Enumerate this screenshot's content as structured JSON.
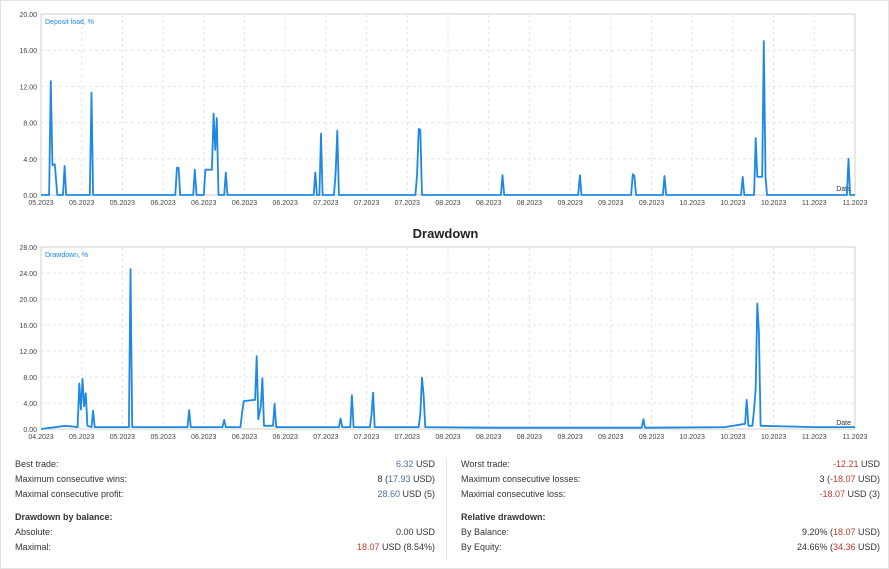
{
  "charts": {
    "deposit_load": {
      "series_label": "Deposit load, %",
      "ticks_y": [
        "0.00",
        "4.00",
        "8.00",
        "12.00",
        "16.00",
        "20.00"
      ],
      "ticks_x": [
        "05.2023",
        "05.2023",
        "05.2023",
        "06.2023",
        "06.2023",
        "06.2023",
        "06.2023",
        "07.2023",
        "07.2023",
        "07.2023",
        "08.2023",
        "08.2023",
        "08.2023",
        "09.2023",
        "09.2023",
        "09.2023",
        "10.2023",
        "10.2023",
        "10.2023",
        "11.2023",
        "11.2023"
      ],
      "x_label": "Date"
    },
    "drawdown": {
      "title": "Drawdown",
      "series_label": "Drawdown, %",
      "ticks_y": [
        "0.00",
        "4.00",
        "8.00",
        "12.00",
        "16.00",
        "20.00",
        "24.00",
        "28.00"
      ],
      "ticks_x": [
        "04.2023",
        "05.2023",
        "05.2023",
        "05.2023",
        "06.2023",
        "06.2023",
        "06.2023",
        "07.2023",
        "07.2023",
        "07.2023",
        "08.2023",
        "08.2023",
        "08.2023",
        "09.2023",
        "09.2023",
        "09.2023",
        "10.2023",
        "10.2023",
        "10.2023",
        "11.2023",
        "11.2023"
      ],
      "x_label": "Date"
    }
  },
  "chart_data": [
    {
      "type": "line",
      "name": "Deposit load, %",
      "ylim": [
        0,
        20
      ],
      "xlabel": "Date",
      "x_range": [
        0,
        100
      ],
      "color": "#1e88e5",
      "points": [
        [
          0,
          0
        ],
        [
          1.0,
          0
        ],
        [
          1.2,
          12.6
        ],
        [
          1.4,
          3.3
        ],
        [
          1.7,
          3.4
        ],
        [
          2.0,
          0
        ],
        [
          2.7,
          0
        ],
        [
          2.9,
          3.2
        ],
        [
          3.1,
          0
        ],
        [
          6.0,
          0
        ],
        [
          6.2,
          11.3
        ],
        [
          6.4,
          0
        ],
        [
          16.5,
          0
        ],
        [
          16.7,
          3.0
        ],
        [
          16.9,
          3.0
        ],
        [
          17.1,
          0
        ],
        [
          18.7,
          0
        ],
        [
          18.9,
          2.8
        ],
        [
          19.1,
          0
        ],
        [
          20.0,
          0
        ],
        [
          20.2,
          2.8
        ],
        [
          21.0,
          2.8
        ],
        [
          21.2,
          9.0
        ],
        [
          21.4,
          5.0
        ],
        [
          21.6,
          8.5
        ],
        [
          21.8,
          0
        ],
        [
          22.5,
          0
        ],
        [
          22.7,
          2.5
        ],
        [
          22.9,
          0
        ],
        [
          33.5,
          0
        ],
        [
          33.7,
          2.5
        ],
        [
          33.9,
          0
        ],
        [
          34.2,
          0
        ],
        [
          34.4,
          6.8
        ],
        [
          34.6,
          0
        ],
        [
          36.0,
          0
        ],
        [
          36.2,
          2.6
        ],
        [
          36.4,
          7.1
        ],
        [
          36.6,
          0
        ],
        [
          46.0,
          0
        ],
        [
          46.2,
          2.3
        ],
        [
          46.4,
          7.3
        ],
        [
          46.6,
          7.2
        ],
        [
          46.8,
          0
        ],
        [
          56.5,
          0
        ],
        [
          56.7,
          2.2
        ],
        [
          56.9,
          0
        ],
        [
          66.0,
          0
        ],
        [
          66.2,
          2.2
        ],
        [
          66.4,
          0
        ],
        [
          72.5,
          0
        ],
        [
          72.7,
          2.3
        ],
        [
          72.9,
          2.1
        ],
        [
          73.1,
          0
        ],
        [
          76.4,
          0
        ],
        [
          76.6,
          2.1
        ],
        [
          76.8,
          0
        ],
        [
          86.0,
          0
        ],
        [
          86.2,
          2.0
        ],
        [
          86.4,
          0
        ],
        [
          87.6,
          0
        ],
        [
          87.8,
          6.3
        ],
        [
          88.0,
          2.0
        ],
        [
          88.6,
          2.0
        ],
        [
          88.8,
          17.0
        ],
        [
          89.0,
          2.0
        ],
        [
          89.2,
          0
        ],
        [
          99.0,
          0
        ],
        [
          99.2,
          4.0
        ],
        [
          99.4,
          0
        ],
        [
          100,
          0
        ]
      ]
    },
    {
      "type": "line",
      "name": "Drawdown, %",
      "ylim": [
        0,
        28
      ],
      "xlabel": "Date",
      "x_range": [
        0,
        100
      ],
      "color": "#1e88e5",
      "points": [
        [
          0,
          0
        ],
        [
          3.0,
          0.5
        ],
        [
          4.5,
          0.3
        ],
        [
          4.7,
          7.0
        ],
        [
          4.9,
          3.0
        ],
        [
          5.1,
          7.7
        ],
        [
          5.3,
          3.5
        ],
        [
          5.5,
          5.5
        ],
        [
          5.7,
          0.5
        ],
        [
          6.2,
          0.3
        ],
        [
          6.4,
          2.8
        ],
        [
          6.6,
          0.3
        ],
        [
          10.8,
          0.3
        ],
        [
          11.0,
          24.6
        ],
        [
          11.2,
          0.3
        ],
        [
          18.0,
          0.3
        ],
        [
          18.2,
          2.9
        ],
        [
          18.4,
          0.3
        ],
        [
          22.3,
          0.3
        ],
        [
          22.5,
          1.4
        ],
        [
          22.7,
          0.3
        ],
        [
          24.5,
          0.3
        ],
        [
          24.7,
          2.5
        ],
        [
          24.9,
          4.3
        ],
        [
          26.3,
          4.5
        ],
        [
          26.5,
          11.2
        ],
        [
          26.7,
          1.5
        ],
        [
          27.0,
          3.5
        ],
        [
          27.2,
          7.8
        ],
        [
          27.4,
          0.5
        ],
        [
          28.5,
          0.5
        ],
        [
          28.7,
          3.9
        ],
        [
          28.9,
          0.3
        ],
        [
          36.6,
          0.3
        ],
        [
          36.8,
          1.6
        ],
        [
          37.0,
          0.3
        ],
        [
          38.0,
          0.3
        ],
        [
          38.2,
          5.2
        ],
        [
          38.4,
          0.3
        ],
        [
          40.4,
          0.3
        ],
        [
          40.6,
          2.2
        ],
        [
          40.8,
          5.6
        ],
        [
          41.0,
          0.3
        ],
        [
          46.4,
          0.3
        ],
        [
          46.6,
          2.3
        ],
        [
          46.8,
          7.9
        ],
        [
          47.0,
          5.3
        ],
        [
          47.2,
          0.3
        ],
        [
          56.0,
          0.2
        ],
        [
          66.0,
          0.2
        ],
        [
          73.8,
          0.2
        ],
        [
          74.0,
          1.5
        ],
        [
          74.2,
          0.2
        ],
        [
          84.0,
          0.3
        ],
        [
          86.5,
          0.8
        ],
        [
          86.7,
          4.5
        ],
        [
          86.9,
          0.5
        ],
        [
          87.4,
          0.5
        ],
        [
          87.6,
          3.0
        ],
        [
          87.8,
          6.3
        ],
        [
          88.0,
          19.3
        ],
        [
          88.2,
          15.0
        ],
        [
          88.4,
          0.5
        ],
        [
          95.0,
          0.3
        ],
        [
          100,
          0.3
        ]
      ]
    }
  ],
  "stats": {
    "left": {
      "best_trade": {
        "label": "Best trade:",
        "value": "6.32",
        "unit": " USD"
      },
      "max_consec_wins": {
        "label": "Maximum consecutive wins:",
        "count": "8 (",
        "amount": "17.93",
        "tail": " USD)"
      },
      "max_consec_profit": {
        "label": "Maximal consecutive profit:",
        "amount": "28.60",
        "tail": " USD (5)"
      },
      "dd_balance_head": "Drawdown by balance:",
      "absolute": {
        "label": "Absolute:",
        "value": "0.00 USD"
      },
      "maximal": {
        "label": "Maximal:",
        "amount": "18.07",
        "tail": " USD (8.54%)"
      }
    },
    "right": {
      "worst_trade": {
        "label": "Worst trade:",
        "value": "-12.21",
        "unit": " USD"
      },
      "max_consec_losses": {
        "label": "Maximum consecutive losses:",
        "count": "3 (",
        "amount": "-18.07",
        "tail": " USD)"
      },
      "max_consec_loss": {
        "label": "Maximal consecutive loss:",
        "amount": "-18.07",
        "tail": " USD (3)"
      },
      "rel_dd_head": "Relative drawdown:",
      "by_balance": {
        "label": "By Balance:",
        "pct": "9.20% (",
        "amount": "18.07",
        "tail": " USD)"
      },
      "by_equity": {
        "label": "By Equity:",
        "pct": "24.66% (",
        "amount": "34.36",
        "tail": " USD)"
      }
    }
  }
}
